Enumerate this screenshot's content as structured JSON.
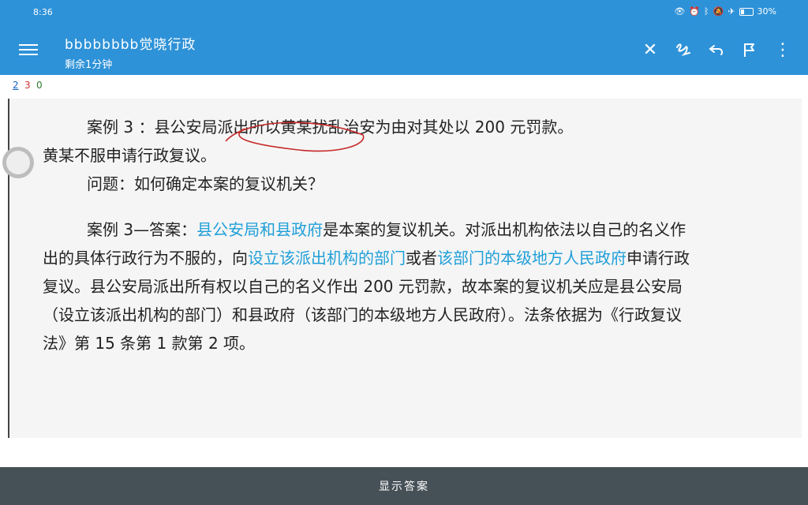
{
  "status_bar": {
    "time": "8:36",
    "battery": "30%"
  },
  "app_bar": {
    "title": "bbbbbbbb觉晓行政",
    "subtitle": "剩余1分钟",
    "icons": [
      "menu-icon",
      "close-icon",
      "scribble-icon",
      "undo-icon",
      "flag-icon",
      "more-vert-icon"
    ]
  },
  "counts": {
    "blue": "2",
    "red": "3",
    "green": "0"
  },
  "content": {
    "case_line1": "案例 3 ：县公安局派出所以黄某扰乱治安为由对其处以 200 元罚款。",
    "case_line2": "黄某不服申请行政复议。",
    "question": "问题：如何确定本案的复议机关？",
    "answer_prefix": "案例 3—答案：",
    "answer_hl1": "县公安局和县政府",
    "answer_mid1": "是本案的复议机关。对派出机构依法以自己的名义作出的具体行政行为不服的，向",
    "answer_hl2": "设立该派出机构的部门",
    "answer_mid2": "或者",
    "answer_hl3": "该部门的本级地方人民政府",
    "answer_rest": "申请行政复议。县公安局派出所有权以自己的名义作出 200 元罚款，故本案的复议机关应是县公安局（设立该派出机构的部门）和县政府（该部门的本级地方人民政府）。法条依据为《行政复议法》第 15 条第 1 款第 2 项。"
  },
  "bottom_bar": {
    "label": "显示答案"
  },
  "colors": {
    "app_bar": "#2e92d8",
    "highlight": "#1f9fd8",
    "bottom_bar": "#465157",
    "annotation": "#c62828"
  }
}
